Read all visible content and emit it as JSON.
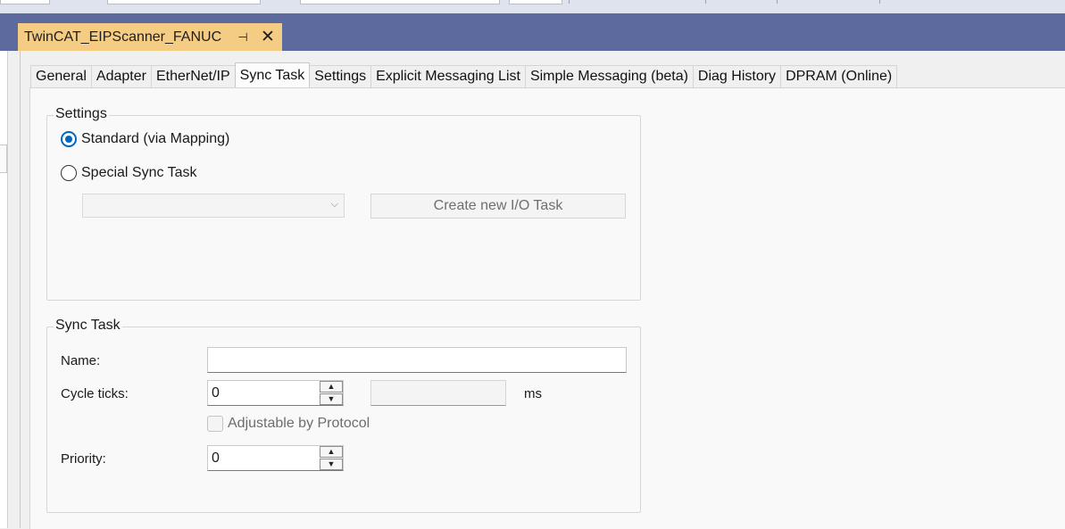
{
  "document_tab": {
    "title": "TwinCAT_EIPScanner_FANUC",
    "pin_icon": "pin-icon",
    "close_icon": "close-icon"
  },
  "tabs": [
    {
      "label": "General",
      "active": false
    },
    {
      "label": "Adapter",
      "active": false
    },
    {
      "label": "EtherNet/IP",
      "active": false
    },
    {
      "label": "Sync Task",
      "active": true
    },
    {
      "label": "Settings",
      "active": false
    },
    {
      "label": "Explicit Messaging List",
      "active": false
    },
    {
      "label": "Simple Messaging (beta)",
      "active": false
    },
    {
      "label": "Diag History",
      "active": false
    },
    {
      "label": "DPRAM (Online)",
      "active": false
    }
  ],
  "settings_group": {
    "legend": "Settings",
    "radio_standard": {
      "label": "Standard (via Mapping)",
      "checked": true
    },
    "radio_special": {
      "label": "Special Sync Task",
      "checked": false
    },
    "task_select_value": "",
    "create_button": "Create new I/O Task"
  },
  "sync_task_group": {
    "legend": "Sync Task",
    "name_label": "Name:",
    "name_value": "",
    "cycle_label": "Cycle ticks:",
    "cycle_value": "0",
    "cycle_ms_value": "",
    "ms_label": "ms",
    "adjustable_label": "Adjustable by Protocol",
    "priority_label": "Priority:",
    "priority_value": "0"
  },
  "colors": {
    "title_bar": "#5c6a9e",
    "doc_tab": "#f5cc84",
    "accent": "#0067c0"
  }
}
